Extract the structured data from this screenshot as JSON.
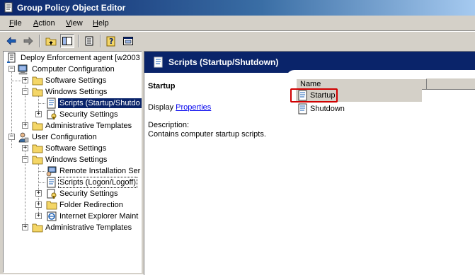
{
  "window": {
    "title": "Group Policy Object Editor"
  },
  "menu": {
    "file": "ile",
    "file_key": "F",
    "action": "ction",
    "action_key": "A",
    "view": "iew",
    "view_key": "V",
    "help": "elp",
    "help_key": "H"
  },
  "toolbar": {
    "buttons": [
      "back-arrow-icon",
      "forward-arrow-icon",
      "up-folder-icon",
      "show-hide-tree-icon",
      "export-list-icon",
      "help-icon",
      "properties-icon"
    ]
  },
  "tree": {
    "root": "Deploy Enforcement agent [w2003",
    "computer_config": "Computer Configuration",
    "cc_software": "Software Settings",
    "cc_windows": "Windows Settings",
    "cc_scripts": "Scripts (Startup/Shutdo",
    "cc_security": "Security Settings",
    "cc_admin": "Administrative Templates",
    "user_config": "User Configuration",
    "uc_software": "Software Settings",
    "uc_windows": "Windows Settings",
    "uc_remote": "Remote Installation Ser",
    "uc_scripts": "Scripts (Logon/Logoff)",
    "uc_security": "Security Settings",
    "uc_folder": "Folder Redirection",
    "uc_ie": "Internet Explorer Maint",
    "uc_admin": "Administrative Templates"
  },
  "detail": {
    "header": "Scripts (Startup/Shutdown)",
    "section_title": "Startup",
    "display_label": "Display",
    "display_link": "Properties",
    "description_label": "Description:",
    "description_text": "Contains computer startup scripts."
  },
  "list": {
    "column_name": "Name",
    "items": [
      "Startup",
      "Shutdown"
    ]
  },
  "colors": {
    "title_bar": "#0a246a",
    "selection": "#0a246a",
    "highlight_box": "#d00000",
    "link": "#0000ee"
  }
}
